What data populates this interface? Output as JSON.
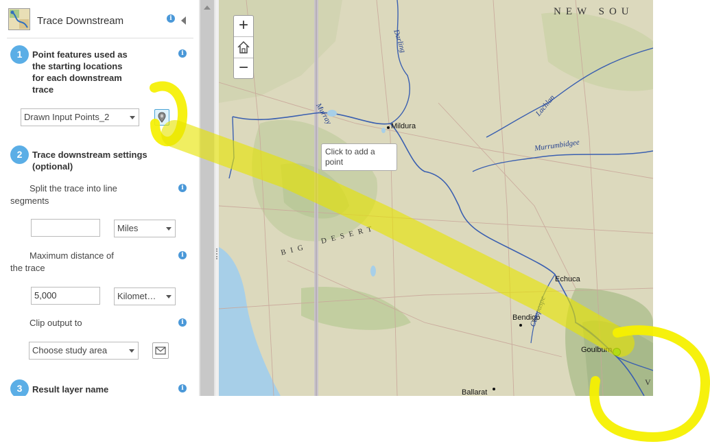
{
  "panel": {
    "title": "Trace Downstream",
    "step1": {
      "number": "1",
      "title": "Point features used as the starting locations for each downstream trace",
      "title_lines": [
        "Point features used as",
        "the starting locations",
        "for each downstream",
        "trace"
      ],
      "select_value": "Drawn Input Points_2"
    },
    "step2": {
      "number": "2",
      "title_lines": [
        "Trace downstream settings",
        "(optional)"
      ],
      "split_label_lines": [
        "Split the trace into line",
        "segments"
      ],
      "split_value": "",
      "split_unit": "Miles",
      "max_label_lines": [
        "Maximum distance of",
        "the trace"
      ],
      "max_value": "5,000",
      "max_unit": "Kilomet…",
      "clip_label": "Clip output to",
      "clip_value": "Choose study area"
    },
    "step3": {
      "number": "3",
      "title": "Result layer name"
    }
  },
  "map": {
    "tooltip_lines": [
      "Click to add a",
      "point"
    ],
    "zoom_in": "+",
    "zoom_out": "−",
    "places": {
      "mildura": "Mildura",
      "echuca": "Echuca",
      "bendigo": "Bendigo",
      "ballarat": "Ballarat",
      "goulburn": "Goulburn"
    },
    "rivers": {
      "darling": "Darling",
      "lachlan": "Lachlan",
      "murrumbidgee": "Murrumbidgee",
      "murray": "Murray",
      "campaspe": "Campaspe"
    },
    "regions": {
      "nsw": "NEW SOU",
      "big_desert_1": "BIG",
      "big_desert_2": "DESERT",
      "vic": "V"
    }
  },
  "colors": {
    "accent": "#5baee6",
    "info": "#4a98d8",
    "highlight": "#f5f000",
    "river": "#3a5fb0",
    "map_base": "#dfdcc0"
  }
}
